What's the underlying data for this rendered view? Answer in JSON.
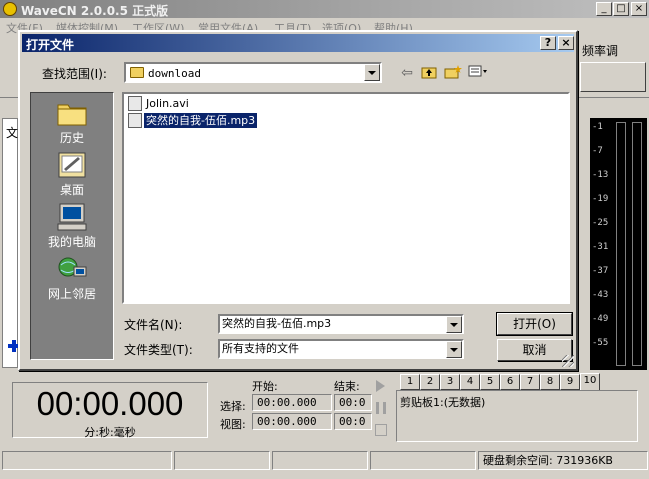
{
  "app": {
    "title": "WaveCN 2.0.0.5 正式版",
    "window_controls": {
      "minimize": "_",
      "maximize": "□",
      "close": "×"
    }
  },
  "menu": [
    "文件(F)",
    "媒体控制(M)",
    "工作区(W)",
    "常用文件(A)",
    "工具(T)",
    "选项(O)",
    "帮助(H)"
  ],
  "toolbar": {
    "rate_label": "频率调"
  },
  "side_tab": "文",
  "meter": {
    "ticks": [
      "-1",
      "-7",
      "-13",
      "-19",
      "-25",
      "-31",
      "-37",
      "-43",
      "-49",
      "-55"
    ]
  },
  "dialog": {
    "title": "打开文件",
    "help": "?",
    "close": "×",
    "look_in_label": "查找范围(I):",
    "look_in_value": "download",
    "places": [
      {
        "label": "历史",
        "icon": "history-folder-icon"
      },
      {
        "label": "桌面",
        "icon": "desktop-icon"
      },
      {
        "label": "我的电脑",
        "icon": "my-computer-icon"
      },
      {
        "label": "网上邻居",
        "icon": "network-icon"
      }
    ],
    "files": [
      {
        "name": "Jolin.avi",
        "selected": false
      },
      {
        "name": "突然的自我-伍佰.mp3",
        "selected": true
      }
    ],
    "filename_label": "文件名(N):",
    "filename_value": "突然的自我-伍佰.mp3",
    "filetype_label": "文件类型(T):",
    "filetype_value": "所有支持的文件",
    "open_button": "打开(O)",
    "cancel_button": "取消"
  },
  "transport": {
    "time": "00:00.000",
    "time_unit": "分:秒:毫秒",
    "start_label": "开始:",
    "end_label": "结束:",
    "select_label": "选择:",
    "view_label": "视图:",
    "select_start": "00:00.000",
    "select_end": "00:0",
    "view_start": "00:00.000",
    "view_end": "00:0"
  },
  "clipboard": {
    "tabs": [
      "1",
      "2",
      "3",
      "4",
      "5",
      "6",
      "7",
      "8",
      "9",
      "10"
    ],
    "active_tab": "10",
    "label": "剪贴板1:(无数据)"
  },
  "status": {
    "disk_free": "硬盘剩余空间: 731936KB"
  }
}
